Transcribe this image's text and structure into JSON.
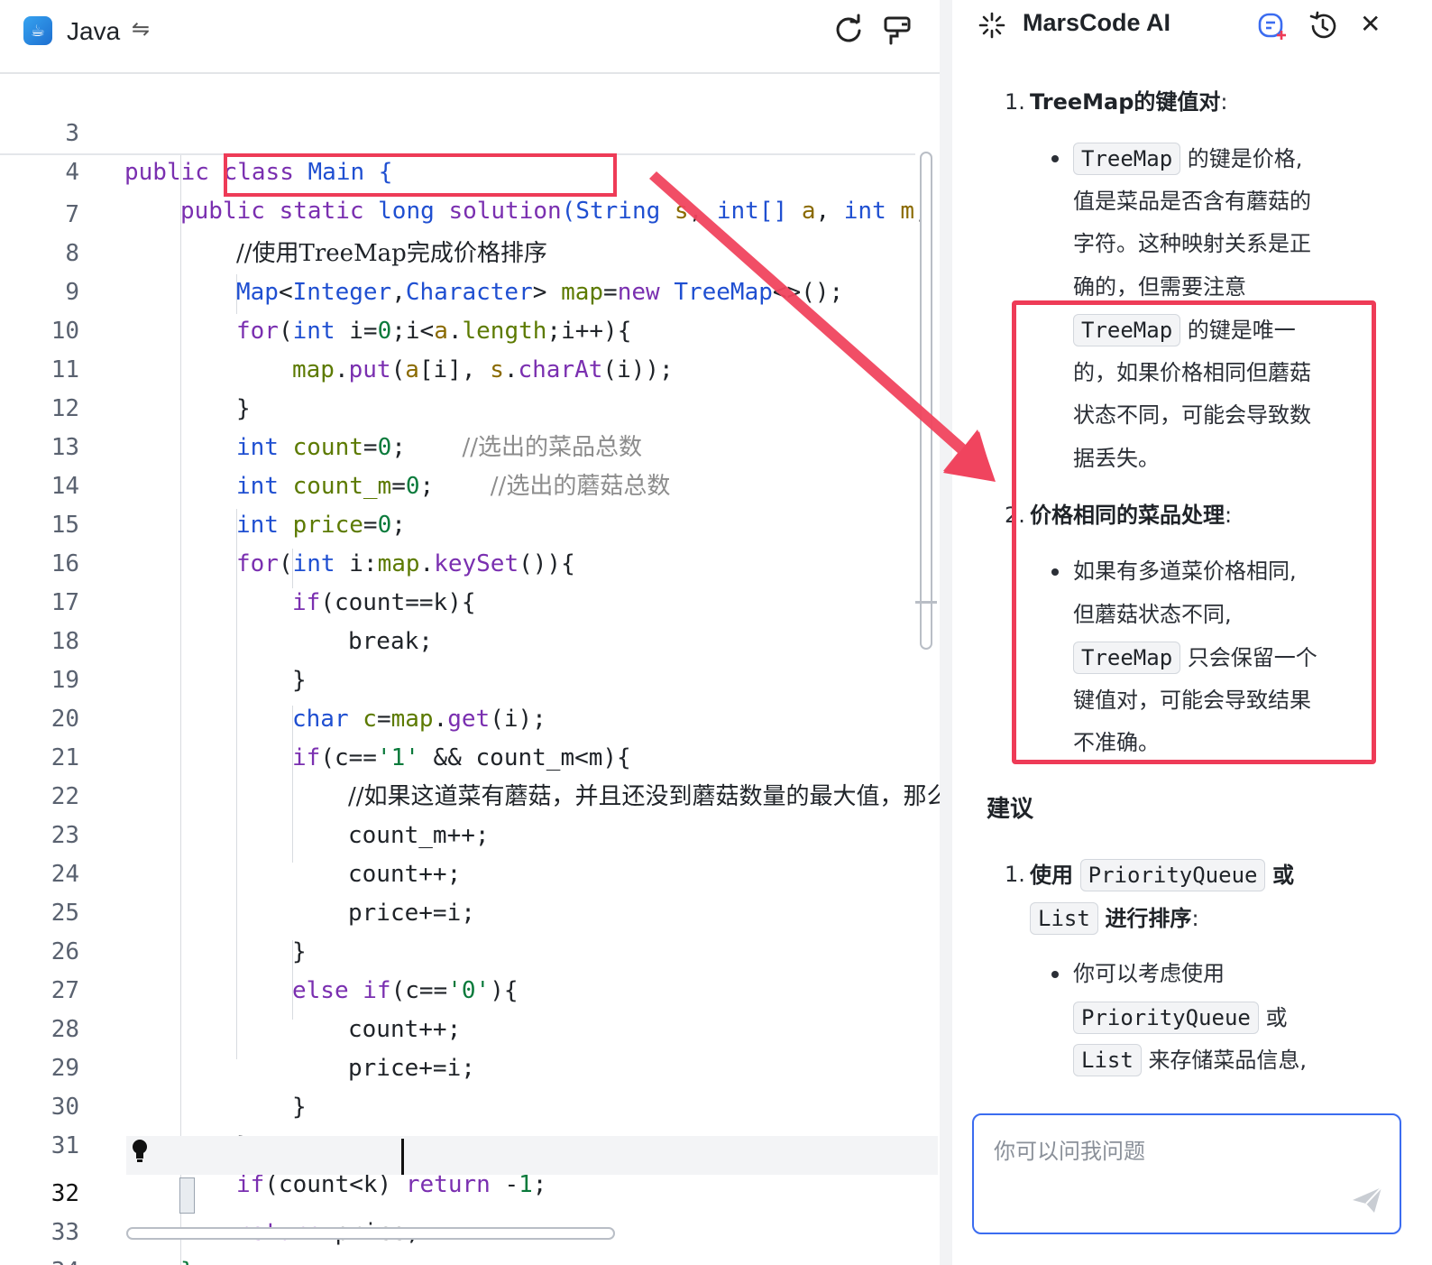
{
  "editor": {
    "language": "Java",
    "line_numbers": [
      "3",
      "4",
      "7",
      "8",
      "9",
      "10",
      "11",
      "12",
      "13",
      "14",
      "15",
      "16",
      "17",
      "18",
      "19",
      "20",
      "21",
      "22",
      "23",
      "24",
      "25",
      "26",
      "27",
      "28",
      "29",
      "30",
      "31",
      "32",
      "33",
      "34"
    ],
    "sticky": {
      "l3": [
        "public",
        "class",
        "Main",
        "{"
      ],
      "l4": [
        "public",
        "static",
        "long",
        "solution",
        "(",
        "String",
        "s",
        ",",
        "int",
        "[]",
        "a",
        ",",
        "int",
        "m",
        ","
      ]
    },
    "code": {
      "l7": "//使用TreeMap完成价格排序",
      "l8": [
        "Map",
        "<",
        "Integer",
        ",",
        "Character",
        ">",
        "map",
        "=",
        "new",
        "TreeMap",
        "<>();"
      ],
      "l9": [
        "for",
        "(",
        "int",
        "i",
        "=",
        "0",
        ";i<",
        "a",
        ".",
        "length",
        ";i++){"
      ],
      "l10": [
        "map",
        ".",
        "put",
        "(",
        "a",
        "[i],",
        "s",
        ".",
        "charAt",
        "(i));"
      ],
      "l11": "}",
      "l12": [
        "int",
        "count",
        "=",
        "0",
        ";",
        "//选出的菜品总数"
      ],
      "l13": [
        "int",
        "count_m",
        "=",
        "0",
        ";",
        "//选出的蘑菇总数"
      ],
      "l14": [
        "int",
        "price",
        "=",
        "0",
        ";"
      ],
      "l15": [
        "for",
        "(",
        "int",
        "i",
        ":",
        "map",
        ".",
        "keySet",
        "()){"
      ],
      "l16": [
        "if",
        "(count==k){"
      ],
      "l17": "break;",
      "l18": "}",
      "l19": [
        "char",
        "c",
        "=",
        "map",
        ".",
        "get",
        "(i);"
      ],
      "l20": [
        "if",
        "(c==",
        "'1'",
        " && count_m<m){"
      ],
      "l21": "//如果这道菜有蘑菇，并且还没到蘑菇数量的最大值，那么",
      "l22": "count_m++;",
      "l23": "count++;",
      "l24": "price+=i;",
      "l25": "}",
      "l26": [
        "else",
        "if",
        "(c==",
        "'0'",
        "){"
      ],
      "l27": "count++;",
      "l28": "price+=i;",
      "l29": "}",
      "l30": "}",
      "l31": [
        "if",
        "(count<k)",
        "return",
        "-",
        "1",
        ";"
      ],
      "l32": [
        "return",
        "price",
        ";"
      ],
      "l33": "}"
    }
  },
  "ai_panel": {
    "title": "MarsCode AI",
    "items": {
      "i1_num": "1.",
      "i1_title": "TreeMap的键值对",
      "i1_colon": ":",
      "chip_treemap": "TreeMap",
      "b1_l1": "的键是价格,",
      "b1_l2": "值是菜品是否含有蘑菇的",
      "b1_l3": "字符。这种映射关系是正",
      "b1_l4": "确的，但需要注意",
      "b1_l5": "的键是唯一",
      "b1_l6": "的，如果价格相同但蘑菇",
      "b1_l7": "状态不同，可能会导致数",
      "b1_l8": "据丢失。",
      "i2_num": "2.",
      "i2_title": "价格相同的菜品处理",
      "i2_colon": ":",
      "b2_l1": "如果有多道菜价格相同,",
      "b2_l2": "但蘑菇状态不同,",
      "b2_l3": "只会保留一个",
      "b2_l4": "键值对，可能会导致结果",
      "b2_l5": "不准确。",
      "suggest_heading": "建议",
      "s1_num": "1.",
      "s1_use": "使用",
      "chip_pq": "PriorityQueue",
      "s1_or": "或",
      "chip_list": "List",
      "s1_sort": "进行排序",
      "s1_colon": ":",
      "sb1_l1": "你可以考虑使用",
      "sb1_or": "或",
      "sb1_l3": "来存储菜品信息,"
    },
    "input_placeholder": "你可以问我问题"
  },
  "colors": {
    "annotation": "#ee3b57",
    "input_border": "#3b6cf0"
  },
  "icons": [
    "java-icon",
    "switch-icon",
    "reset-icon",
    "format-icon",
    "bulb-icon",
    "sparkle-logo-icon",
    "new-chat-icon",
    "history-icon",
    "close-icon",
    "send-icon"
  ]
}
